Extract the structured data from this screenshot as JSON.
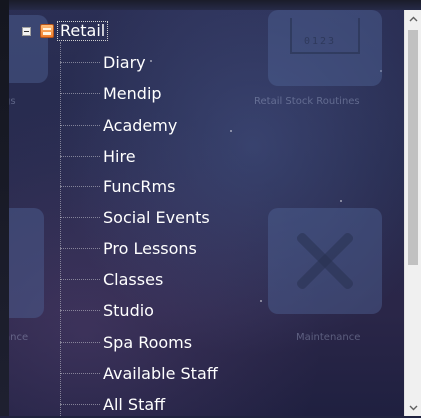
{
  "tree": {
    "root": {
      "label": "Retail",
      "icon": "folder-icon",
      "expanded": true
    },
    "children": [
      {
        "label": "Diary"
      },
      {
        "label": "Mendip"
      },
      {
        "label": "Academy"
      },
      {
        "label": "Hire"
      },
      {
        "label": "FuncRms"
      },
      {
        "label": "Social Events"
      },
      {
        "label": "Pro Lessons"
      },
      {
        "label": "Classes"
      },
      {
        "label": "Studio"
      },
      {
        "label": "Spa Rooms"
      },
      {
        "label": "Available Staff"
      },
      {
        "label": "All Staff"
      }
    ]
  },
  "background_tiles": {
    "retail_stock": "Retail Stock Routines",
    "maintenance": "Maintenance",
    "left_top": "gs",
    "left_bottom": "ance",
    "counter_digits": "0123"
  },
  "scrollbar": {
    "up_icon": "chevron-up-icon",
    "down_icon": "chevron-down-icon",
    "position": 0.0
  },
  "colors": {
    "text": "#ffffff",
    "scrollbar_track": "#f0f0f0",
    "scrollbar_thumb": "#c1c1c1"
  }
}
